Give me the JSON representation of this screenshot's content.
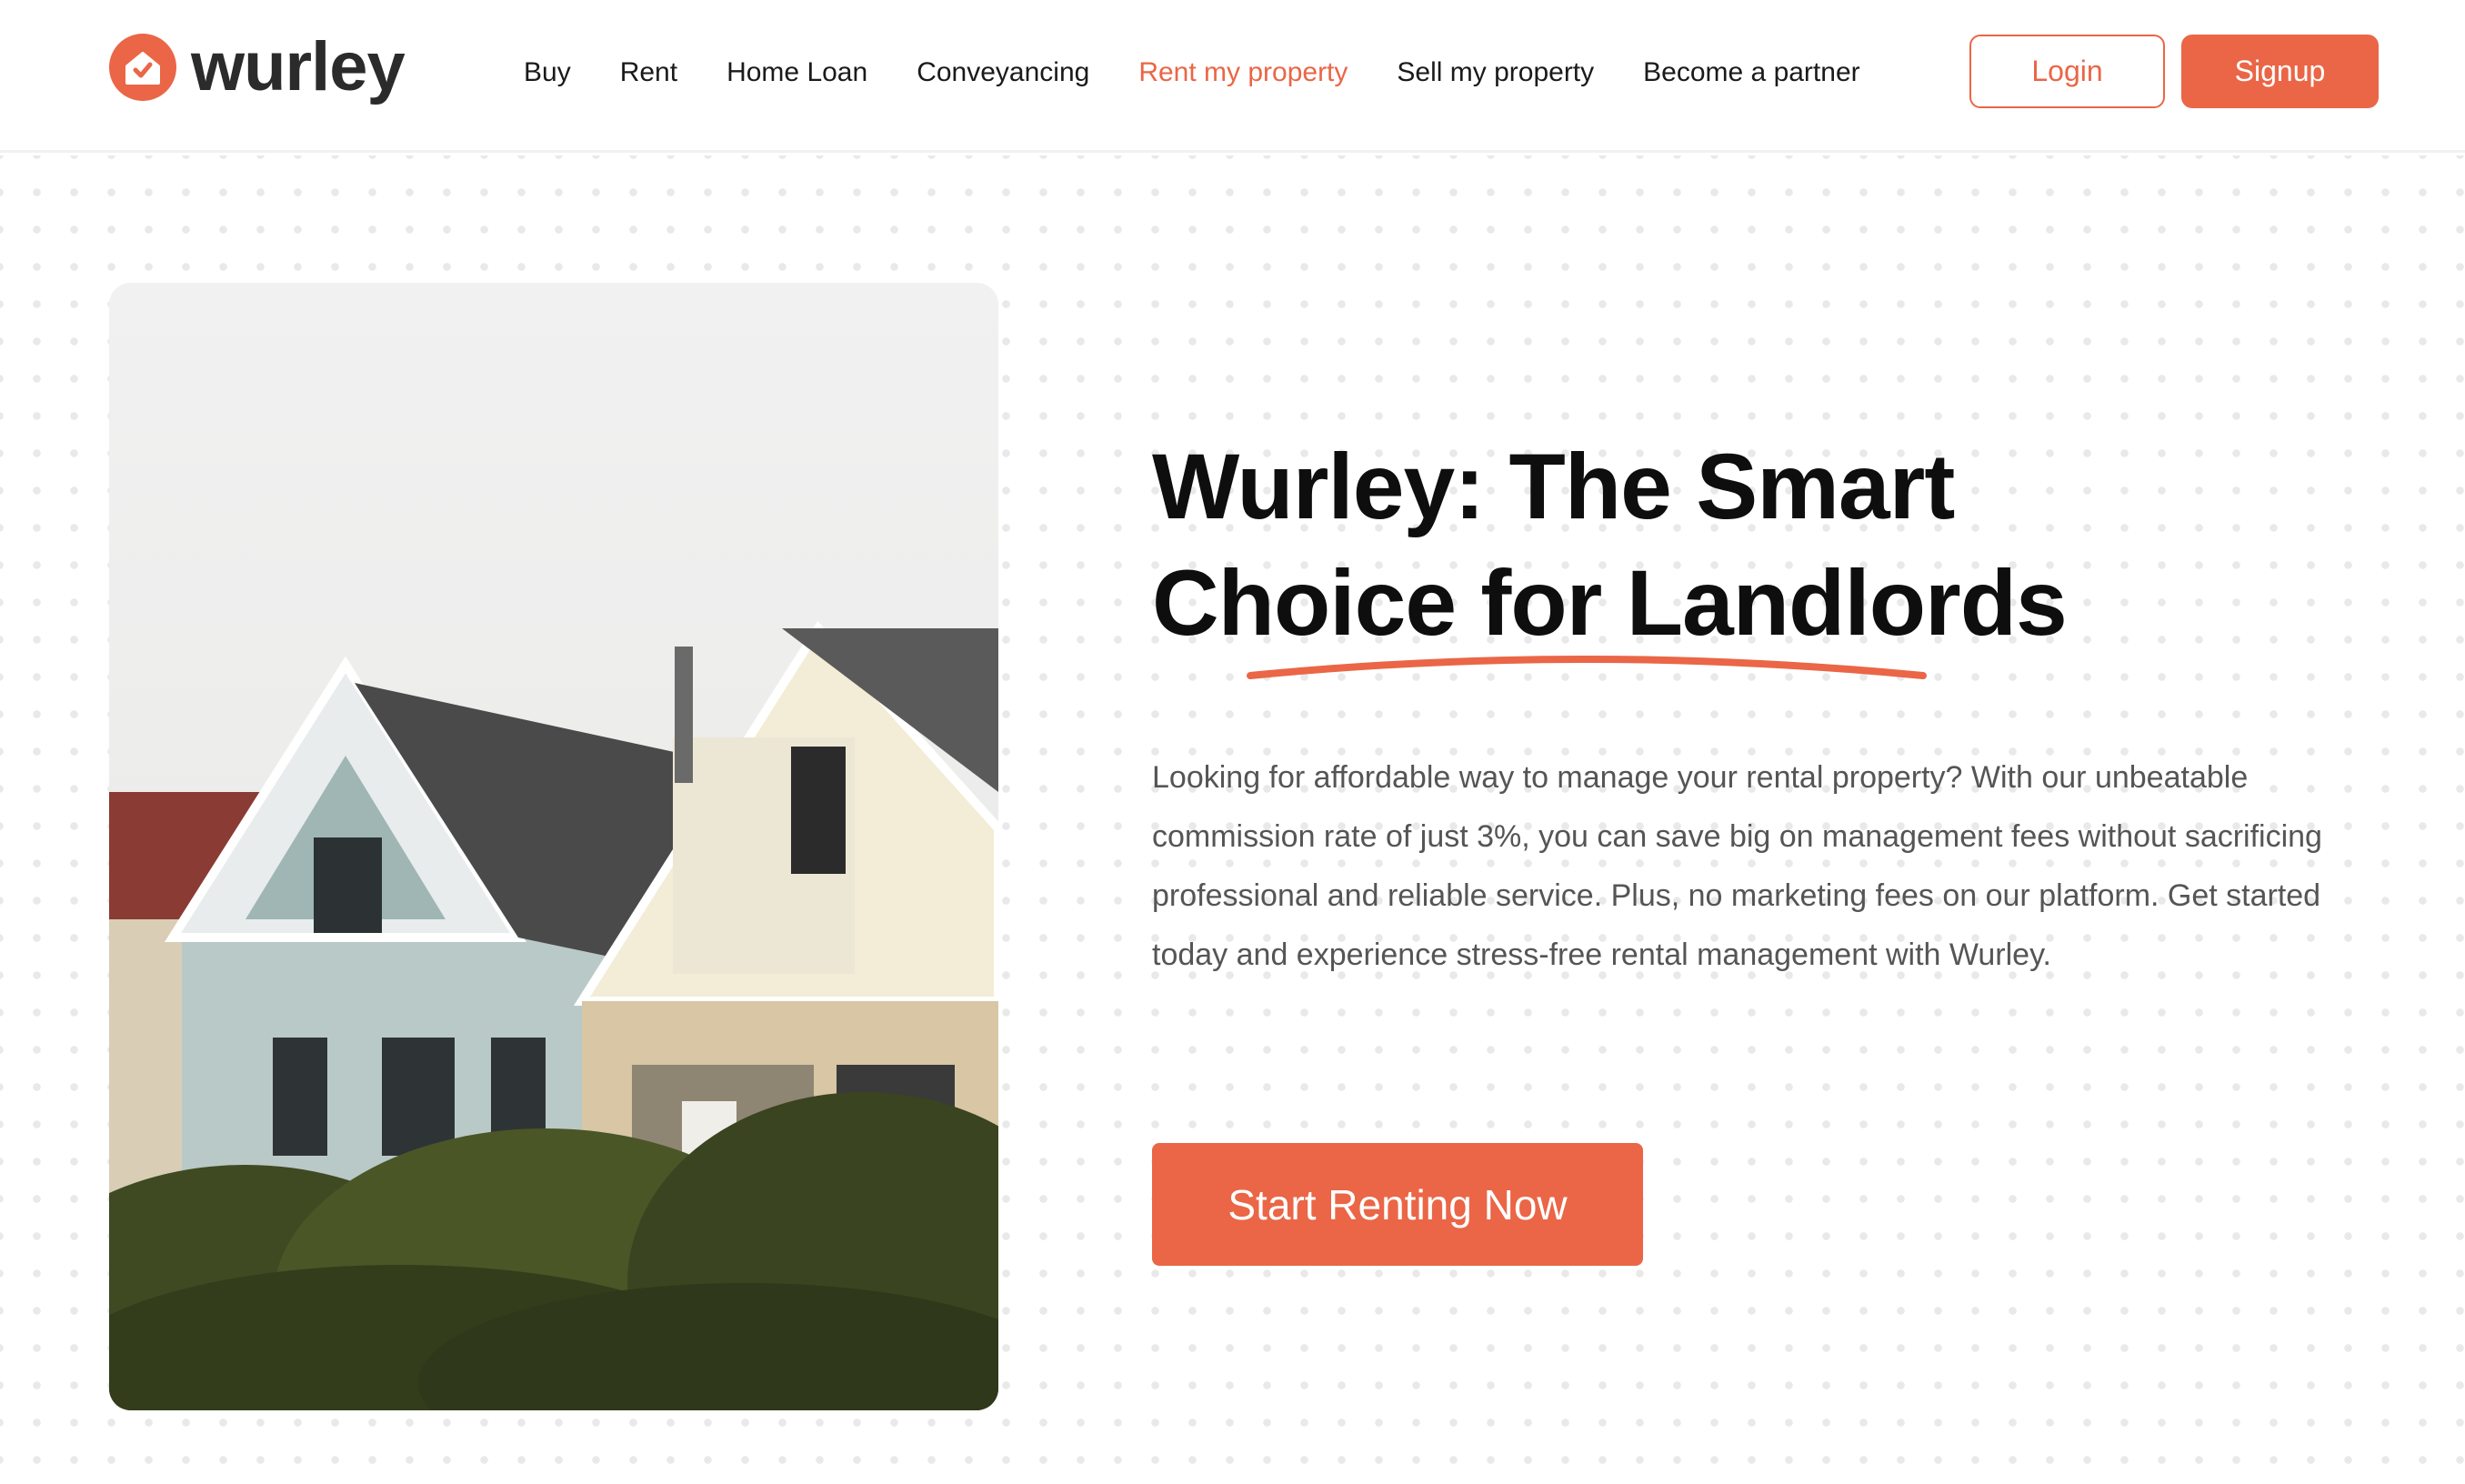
{
  "brand": {
    "name": "wurley",
    "accent_color": "#ea6646",
    "logo_icon": "house-check-icon"
  },
  "nav": {
    "items": [
      {
        "label": "Buy"
      },
      {
        "label": "Rent"
      },
      {
        "label": "Home Loan"
      },
      {
        "label": "Conveyancing"
      },
      {
        "label": "Rent my property",
        "active": true
      },
      {
        "label": "Sell my property"
      },
      {
        "label": "Become a partner"
      }
    ],
    "login_label": "Login",
    "signup_label": "Signup"
  },
  "hero": {
    "headline_line1": "Wurley: The Smart",
    "headline_line2": "Choice for Landlords",
    "body": "Looking for affordable way to manage your rental property? With our unbeatable commission rate of just 3%, you can save big on management fees without sacrificing professional and reliable service. Plus, no marketing fees on our platform. Get started today and experience stress-free rental management with Wurley.",
    "cta_label": "Start Renting Now",
    "image_subject": "victorian-houses-photo"
  }
}
